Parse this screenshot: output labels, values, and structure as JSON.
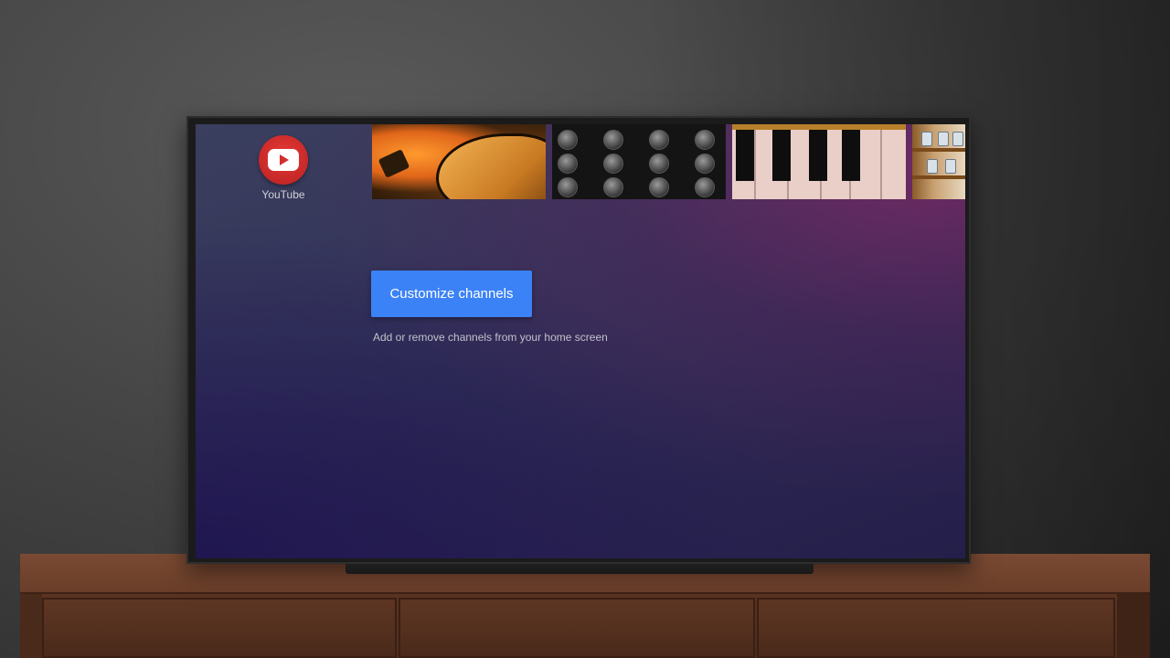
{
  "screen": {
    "app": {
      "label": "YouTube",
      "icon": "youtube-icon",
      "brand_color": "#d32f2f"
    },
    "thumbnails": [
      {
        "subject": "guitar"
      },
      {
        "subject": "mixing-board"
      },
      {
        "subject": "piano-keys"
      },
      {
        "subject": "shelf"
      }
    ],
    "customize": {
      "button_label": "Customize channels",
      "hint": "Add or remove channels from your home screen",
      "accent": "#3b82f6"
    }
  }
}
